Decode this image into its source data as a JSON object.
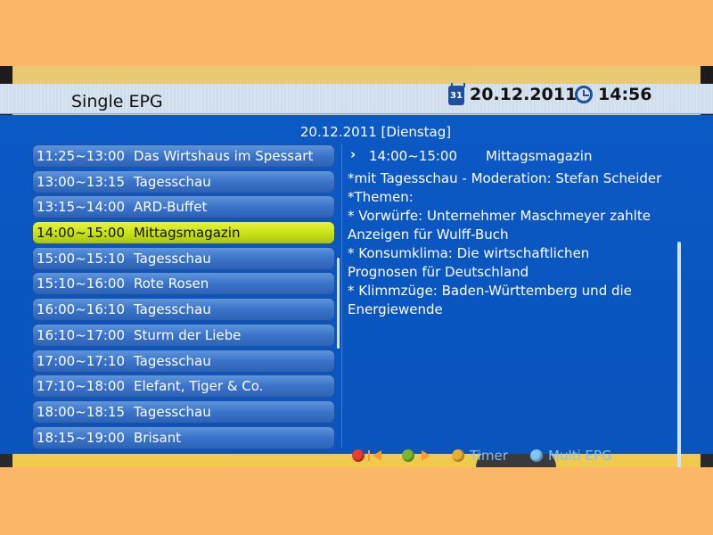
{
  "header": {
    "title": "Single EPG",
    "date_icon_day": "31",
    "date": "20.12.2011",
    "time": "14:56"
  },
  "day_label": "20.12.2011 [Dienstag]",
  "programs": [
    {
      "time": "11:25~13:00",
      "name": "Das Wirtshaus im Spessart"
    },
    {
      "time": "13:00~13:15",
      "name": "Tagesschau"
    },
    {
      "time": "13:15~14:00",
      "name": "ARD-Buffet"
    },
    {
      "time": "14:00~15:00",
      "name": "Mittagsmagazin"
    },
    {
      "time": "15:00~15:10",
      "name": "Tagesschau"
    },
    {
      "time": "15:10~16:00",
      "name": "Rote Rosen"
    },
    {
      "time": "16:00~16:10",
      "name": "Tagesschau"
    },
    {
      "time": "16:10~17:00",
      "name": "Sturm der Liebe"
    },
    {
      "time": "17:00~17:10",
      "name": "Tagesschau"
    },
    {
      "time": "17:10~18:00",
      "name": "Elefant, Tiger & Co."
    },
    {
      "time": "18:00~18:15",
      "name": "Tagesschau"
    },
    {
      "time": "18:15~19:00",
      "name": "Brisant"
    }
  ],
  "selected_index": 3,
  "detail": {
    "arrow": "›",
    "time": "14:00~15:00",
    "title": "Mittagsmagazin",
    "lines": [
      "*mit Tagesschau - Moderation: Stefan Scheider",
      "*Themen:",
      "* Vorwürfe: Unternehmer Maschmeyer zahlte",
      "Anzeigen für Wulff-Buch",
      "* Konsumklima: Die wirtschaftlichen",
      "Prognosen für Deutschland",
      "* Klimmzüge: Baden-Württemberg und die",
      "Energiewende"
    ]
  },
  "legend": {
    "timer_label": "Timer",
    "multi_epg_label": "Multi EPG"
  },
  "colors": {
    "panel_blue": "#0b59c5",
    "selected_row": "#c9e016",
    "red_key": "#e8402a",
    "green_key": "#7ab82a",
    "yellow_key": "#e9b030",
    "blue_key": "#7fc7f0",
    "legend_text": "#7fc0ff"
  },
  "icons": {
    "date": "calendar-icon",
    "time": "clock-icon",
    "prev_day": "red-key-prev-icon",
    "next_day": "green-key-next-icon",
    "timer": "yellow-key-icon",
    "multi_epg": "blue-key-icon"
  }
}
